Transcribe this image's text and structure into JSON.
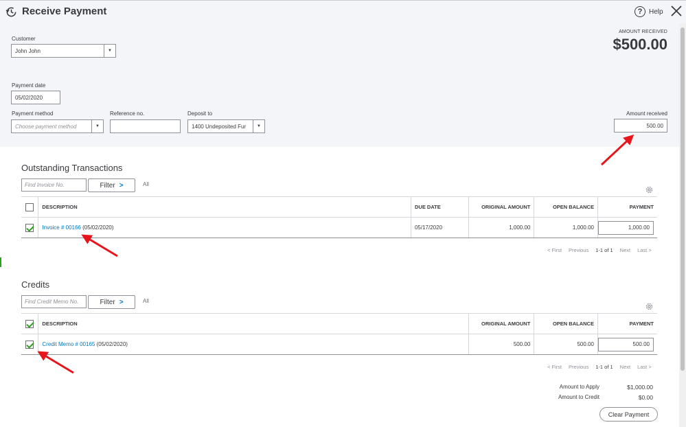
{
  "header": {
    "title": "Receive Payment",
    "help_label": "Help"
  },
  "form": {
    "customer_label": "Customer",
    "customer_value": "John John",
    "payment_date_label": "Payment date",
    "payment_date_value": "05/02/2020",
    "payment_method_label": "Payment method",
    "payment_method_placeholder": "Choose payment method",
    "reference_label": "Reference no.",
    "reference_value": "",
    "deposit_to_label": "Deposit to",
    "deposit_to_value": "1400 Undeposited Fur",
    "amount_received_caption": "AMOUNT RECEIVED",
    "amount_received_big": "$500.00",
    "amount_received_label": "Amount received",
    "amount_received_value": "500.00"
  },
  "outstanding": {
    "title": "Outstanding Transactions",
    "find_placeholder": "Find Invoice No.",
    "filter_label": "Filter",
    "all_label": "All",
    "columns": [
      "DESCRIPTION",
      "DUE DATE",
      "ORIGINAL AMOUNT",
      "OPEN BALANCE",
      "PAYMENT"
    ],
    "rows": [
      {
        "link": "Invoice # 00166",
        "date": "(05/02/2020)",
        "due_date": "05/17/2020",
        "original_amount": "1,000.00",
        "open_balance": "1,000.00",
        "payment": "1,000.00",
        "checked": true
      }
    ],
    "pager": {
      "first": "< First",
      "previous": "Previous",
      "range": "1-1 of 1",
      "next": "Next",
      "last": "Last >"
    }
  },
  "credits": {
    "title": "Credits",
    "find_placeholder": "Find Credit Memo No.",
    "filter_label": "Filter",
    "all_label": "All",
    "columns": [
      "DESCRIPTION",
      "ORIGINAL AMOUNT",
      "OPEN BALANCE",
      "PAYMENT"
    ],
    "rows": [
      {
        "link": "Credit Memo # 00165",
        "date": "(05/02/2020)",
        "original_amount": "500.00",
        "open_balance": "500.00",
        "payment": "500.00",
        "checked": true
      }
    ],
    "pager": {
      "first": "< First",
      "previous": "Previous",
      "range": "1-1 of 1",
      "next": "Next",
      "last": "Last >"
    }
  },
  "totals": {
    "amount_to_apply_label": "Amount to Apply",
    "amount_to_apply_value": "$1,000.00",
    "amount_to_credit_label": "Amount to Credit",
    "amount_to_credit_value": "$0.00"
  },
  "clear_payment_label": "Clear Payment",
  "colors": {
    "accent": "#0077c5",
    "check": "#2ca01c",
    "annotation_arrow": "#e8141b",
    "panel_bg": "#f4f5f8"
  }
}
